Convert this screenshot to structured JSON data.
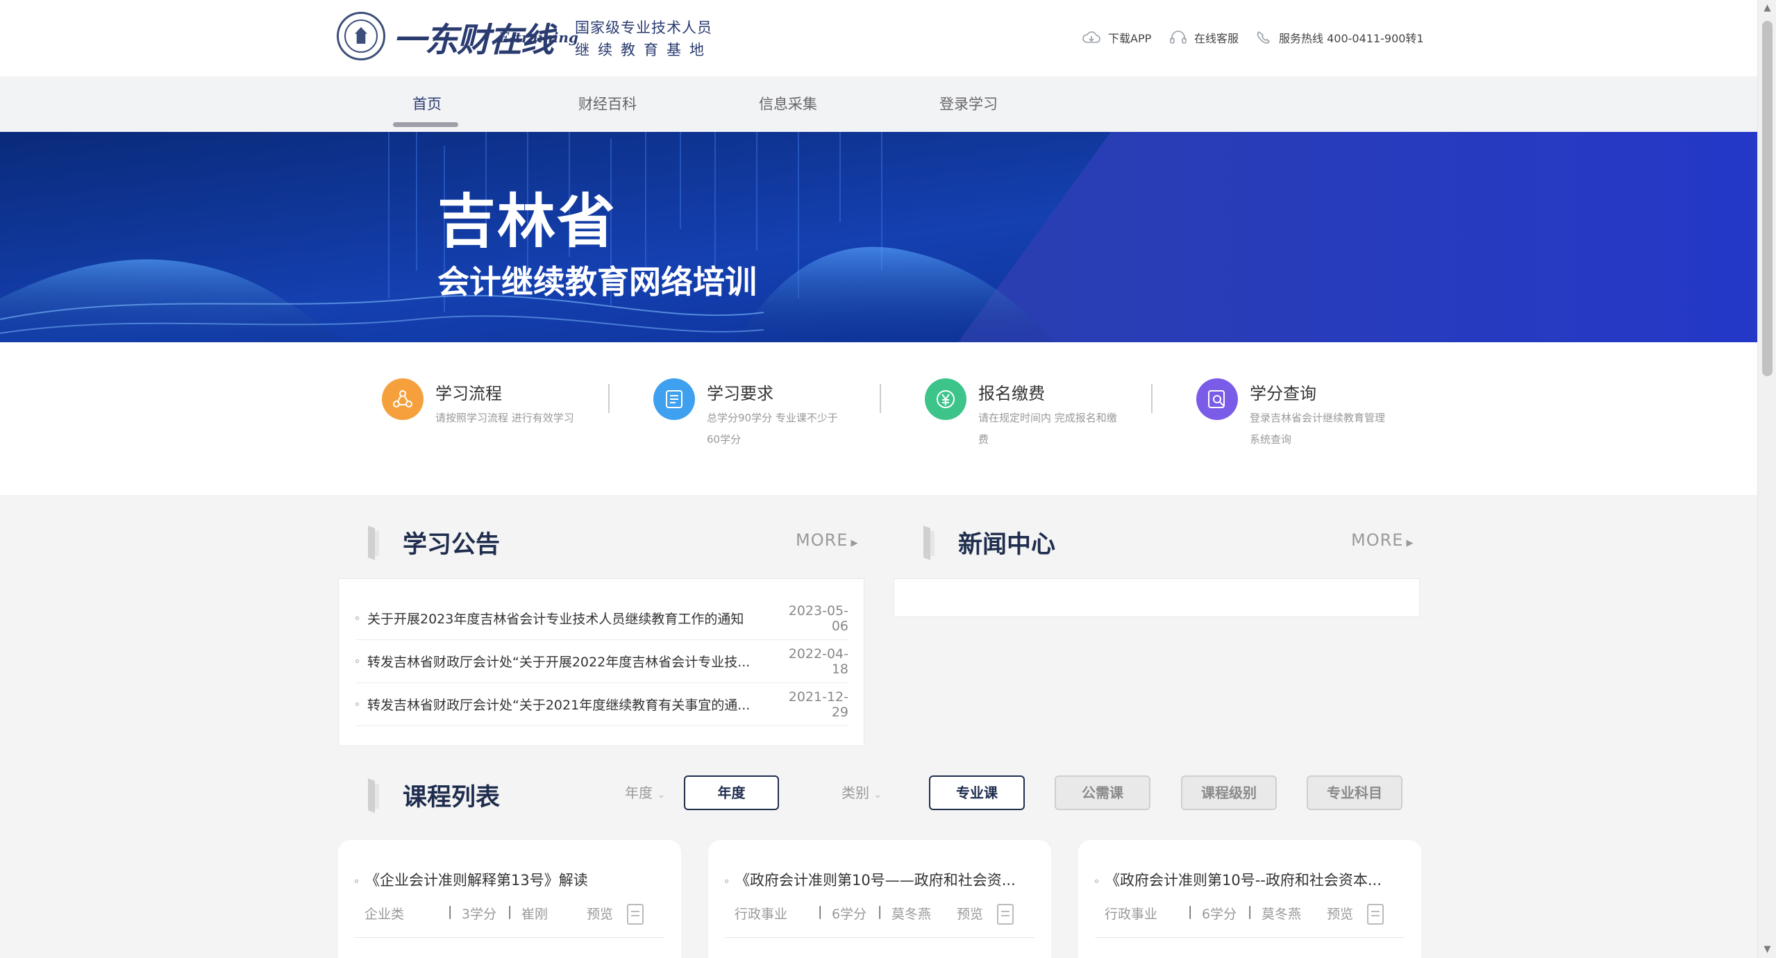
{
  "header": {
    "brand_logo": "一东财在线",
    "brand_sub": "E-training",
    "slogan_line1": "国家级专业技术人员",
    "slogan_line2": "继续教育基地",
    "download_app": "下载APP",
    "online_service": "在线客服",
    "hotline": "服务热线 400-0411-900转1"
  },
  "nav": {
    "items": [
      {
        "label": "首页",
        "active": true
      },
      {
        "label": "财经百科"
      },
      {
        "label": "信息采集"
      },
      {
        "label": "登录学习"
      }
    ]
  },
  "banner": {
    "title": "吉林省",
    "subtitle": "会计继续教育网络培训"
  },
  "features": [
    {
      "title": "学习流程",
      "desc": "请按照学习流程 进行有效学习",
      "color": "#f5a03c",
      "icon": "flow-icon"
    },
    {
      "title": "学习要求",
      "desc": "总学分90学分 专业课不少于60学分",
      "color": "#3fa0f0",
      "icon": "document-icon"
    },
    {
      "title": "报名缴费",
      "desc": "请在规定时间内 完成报名和缴费",
      "color": "#3cc48a",
      "icon": "yuan-icon"
    },
    {
      "title": "学分查询",
      "desc": "登录吉林省会计继续教育管理系统查询",
      "color": "#7a5ce8",
      "icon": "search-doc-icon"
    }
  ],
  "notices": {
    "title": "学习公告",
    "more": "MORE",
    "items": [
      {
        "title": "关于开展2023年度吉林省会计专业技术人员继续教育工作的通知",
        "date": "2023-05-06"
      },
      {
        "title": "转发吉林省财政厅会计处“关于开展2022年度吉林省会计专业技...",
        "date": "2022-04-18"
      },
      {
        "title": "转发吉林省财政厅会计处“关于2021年度继续教育有关事宜的通...",
        "date": "2021-12-29"
      }
    ]
  },
  "news": {
    "title": "新闻中心",
    "more": "MORE"
  },
  "courses": {
    "title": "课程列表",
    "year_label": "年度",
    "year_value": "年度",
    "category_label": "类别",
    "filters": [
      "专业课",
      "公需课",
      "课程级别",
      "专业科目"
    ],
    "preview_label": "预览",
    "cards": [
      {
        "title": "《企业会计准则解释第13号》解读",
        "type": "企业类",
        "credits": "3学分",
        "teacher": "崔刚"
      },
      {
        "title": "《政府会计准则第10号——政府和社会资...",
        "type": "行政事业",
        "credits": "6学分",
        "teacher": "莫冬燕"
      },
      {
        "title": "《政府会计准则第10号--政府和社会资本...",
        "type": "行政事业",
        "credits": "6学分",
        "teacher": "莫冬燕"
      }
    ]
  }
}
